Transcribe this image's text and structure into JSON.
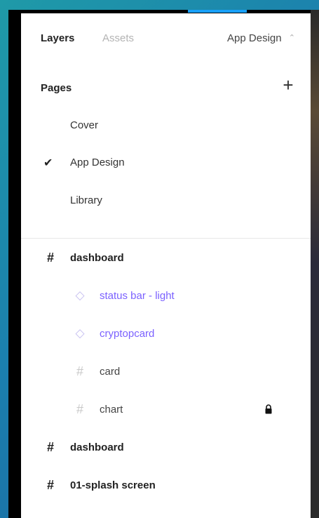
{
  "tabs": {
    "layers": "Layers",
    "assets": "Assets"
  },
  "current_page": "App Design",
  "pages_section": {
    "title": "Pages",
    "items": [
      {
        "label": "Cover",
        "selected": false
      },
      {
        "label": "App Design",
        "selected": true
      },
      {
        "label": "Library",
        "selected": false
      }
    ]
  },
  "layers": [
    {
      "label": "dashboard",
      "kind": "frame",
      "icon": "frame-icon"
    },
    {
      "label": "status bar - light",
      "kind": "component-instance",
      "icon": "component-instance-icon"
    },
    {
      "label": "cryptopcard",
      "kind": "component-instance",
      "icon": "component-instance-icon"
    },
    {
      "label": "card",
      "kind": "frame",
      "icon": "frame-icon"
    },
    {
      "label": "chart",
      "kind": "frame",
      "icon": "frame-icon",
      "locked": true
    },
    {
      "label": "dashboard",
      "kind": "frame",
      "icon": "frame-icon"
    },
    {
      "label": "01-splash screen",
      "kind": "frame",
      "icon": "frame-icon"
    }
  ],
  "colors": {
    "accent": "#18a0fb",
    "component": "#7b61ff"
  }
}
